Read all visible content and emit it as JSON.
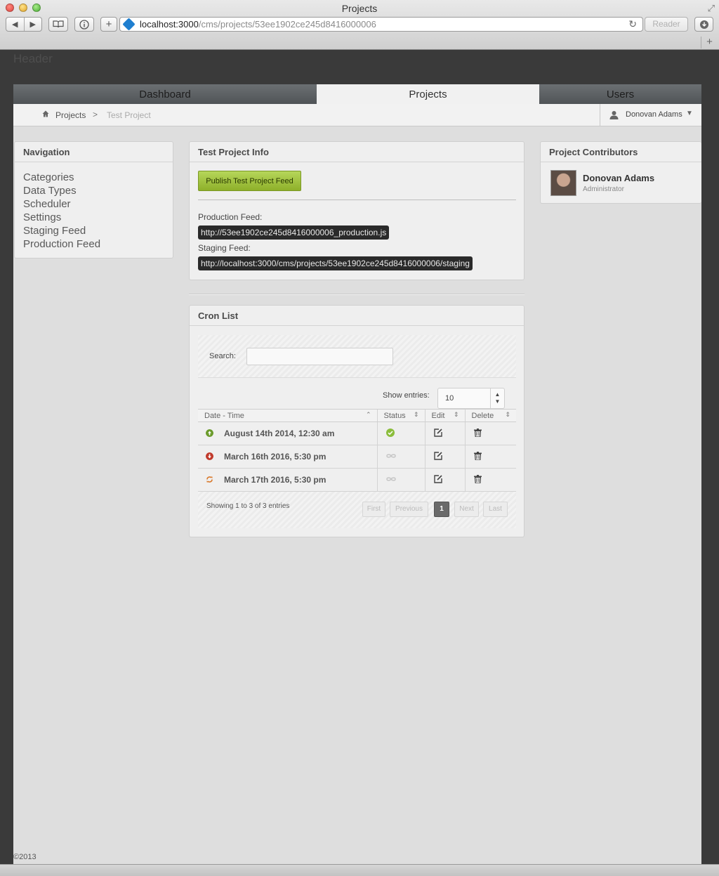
{
  "browser": {
    "window_title": "Projects",
    "url_host": "localhost:3000",
    "url_path": "/cms/projects/53ee1902ce245d8416000006",
    "reader_label": "Reader"
  },
  "page_header": "Header",
  "tabs": [
    {
      "label": "Dashboard",
      "active": false
    },
    {
      "label": "Projects",
      "active": true
    },
    {
      "label": "Users",
      "active": false
    }
  ],
  "breadcrumb": {
    "root": "Projects",
    "separator": ">",
    "current": "Test Project"
  },
  "user_menu": {
    "name": "Donovan Adams"
  },
  "navigation": {
    "title": "Navigation",
    "items": [
      "Categories",
      "Data Types",
      "Scheduler",
      "Settings",
      "Staging Feed",
      "Production Feed"
    ]
  },
  "project_info": {
    "title": "Test Project Info",
    "publish_button": "Publish Test Project Feed",
    "production_label": "Production Feed:",
    "production_url": "http://53ee1902ce245d8416000006_production.js",
    "staging_label": "Staging Feed:",
    "staging_url": "http://localhost:3000/cms/projects/53ee1902ce245d8416000006/staging"
  },
  "cron_list": {
    "title": "Cron List",
    "search_label": "Search:",
    "search_value": "",
    "show_entries_label": "Show entries:",
    "show_entries_value": "10",
    "columns": [
      "Date - Time",
      "Status",
      "Edit",
      "Delete"
    ],
    "rows": [
      {
        "datetime": "August 14th 2014, 12:30 am",
        "direction": "up",
        "status": "complete"
      },
      {
        "datetime": "March 16th 2016, 5:30 pm",
        "direction": "down",
        "status": "pending"
      },
      {
        "datetime": "March 17th 2016, 5:30 pm",
        "direction": "repeat",
        "status": "pending"
      }
    ],
    "showing_text": "Showing 1 to 3 of 3 entries",
    "pagination": {
      "first": "First",
      "previous": "Previous",
      "current": "1",
      "next": "Next",
      "last": "Last"
    }
  },
  "contributors": {
    "title": "Project Contributors",
    "people": [
      {
        "name": "Donovan Adams",
        "role": "Administrator"
      }
    ]
  },
  "footer": {
    "copyright": "©2013"
  },
  "colors": {
    "publish_green": "#9cc23a",
    "up_icon": "#6a9a2a",
    "down_icon": "#c0392b",
    "repeat_icon": "#d9782a",
    "status_ok": "#8bbd3c",
    "status_pending": "#c6c6c6",
    "feed_bg": "#2a2a2a"
  }
}
